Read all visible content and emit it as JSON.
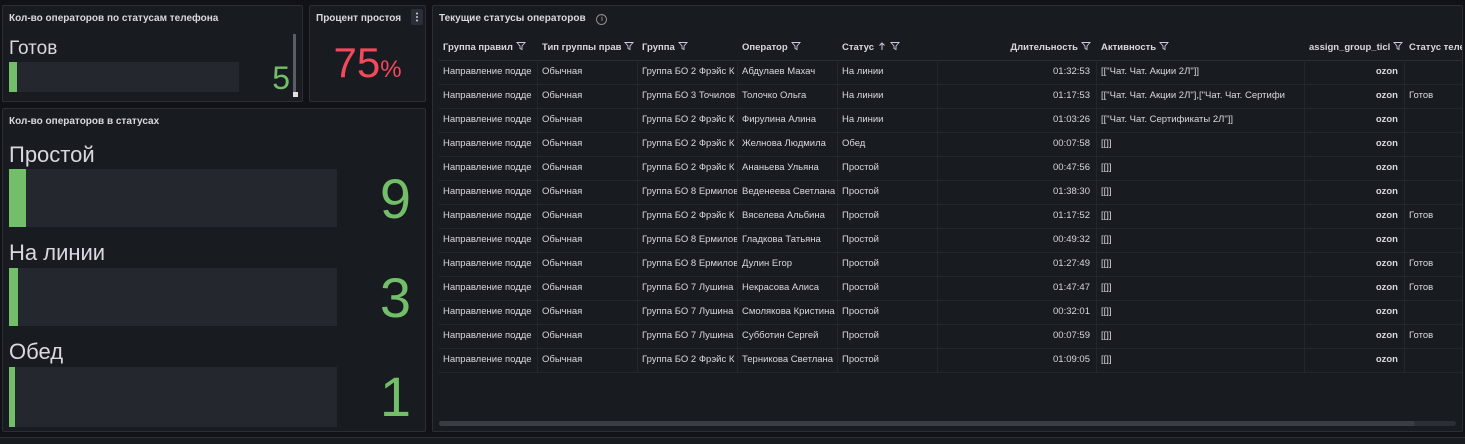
{
  "phone_panel": {
    "title": "Кол-во операторов по статусам телефона",
    "rows": [
      {
        "label": "Готов",
        "value": "5",
        "fill": 0.02
      }
    ]
  },
  "idle_panel": {
    "title": "Процент простоя",
    "value": "75",
    "unit": "%",
    "value_color": "#f2495c"
  },
  "status_panel": {
    "title": "Кол-во операторов в статусах",
    "rows": [
      {
        "label": "Простой",
        "value": "9",
        "fill": 0.036
      },
      {
        "label": "На линии",
        "value": "3",
        "fill": 0.012
      },
      {
        "label": "Обед",
        "value": "1",
        "fill": 0.004
      }
    ]
  },
  "table_panel": {
    "title": "Текущие статусы операторов",
    "columns": [
      "Группа правил",
      "Тип группы прав",
      "Группа",
      "Оператор",
      "Статус",
      "Длительность",
      "Активность",
      "assign_group_ticl",
      "Статус теле"
    ],
    "sort_column": "Статус",
    "rows": [
      [
        "Направление подде",
        "Обычная",
        "Группа БО 2 Фрэйс К",
        "Абдулаев Махач",
        "На линии",
        "01:32:53",
        "[[\"Чат. Чат. Акции 2Л\"]]",
        "ozon",
        ""
      ],
      [
        "Направление подде",
        "Обычная",
        "Группа БО 3 Точилов",
        "Толочко Ольга",
        "На линии",
        "01:17:53",
        "[[\"Чат. Чат. Акции 2Л\"],[\"Чат. Чат. Сертифи",
        "ozon",
        "Готов"
      ],
      [
        "Направление подде",
        "Обычная",
        "Группа БО 2 Фрэйс К",
        "Фирулина Алина",
        "На линии",
        "01:03:26",
        "[[\"Чат. Чат. Сертификаты 2Л\"]]",
        "ozon",
        ""
      ],
      [
        "Направление подде",
        "Обычная",
        "Группа БО 2 Фрэйс К",
        "Желнова Людмила",
        "Обед",
        "00:07:58",
        "[[]]",
        "ozon",
        ""
      ],
      [
        "Направление подде",
        "Обычная",
        "Группа БО 2 Фрэйс К",
        "Ананьева Ульяна",
        "Простой",
        "00:47:56",
        "[[]]",
        "ozon",
        ""
      ],
      [
        "Направление подде",
        "Обычная",
        "Группа БО 8 Ермилов",
        "Веденеева Светлана",
        "Простой",
        "01:38:30",
        "[[]]",
        "ozon",
        ""
      ],
      [
        "Направление подде",
        "Обычная",
        "Группа БО 2 Фрэйс К",
        "Вяселева Альбина",
        "Простой",
        "01:17:52",
        "[[]]",
        "ozon",
        "Готов"
      ],
      [
        "Направление подде",
        "Обычная",
        "Группа БО 8 Ермилов",
        "Гладкова Татьяна",
        "Простой",
        "00:49:32",
        "[[]]",
        "ozon",
        ""
      ],
      [
        "Направление подде",
        "Обычная",
        "Группа БО 8 Ермилов",
        "Дулин Егор",
        "Простой",
        "01:27:49",
        "[[]]",
        "ozon",
        "Готов"
      ],
      [
        "Направление подде",
        "Обычная",
        "Группа БО 7 Лушина",
        "Некрасова Алиса",
        "Простой",
        "01:47:47",
        "[[]]",
        "ozon",
        "Готов"
      ],
      [
        "Направление подде",
        "Обычная",
        "Группа БО 7 Лушина",
        "Смолякова Кристина",
        "Простой",
        "00:32:01",
        "[[]]",
        "ozon",
        ""
      ],
      [
        "Направление подде",
        "Обычная",
        "Группа БО 7 Лушина",
        "Субботин Сергей",
        "Простой",
        "00:07:59",
        "[[]]",
        "ozon",
        "Готов"
      ],
      [
        "Направление подде",
        "Обычная",
        "Группа БО 2 Фрэйс К",
        "Терникова Светлана",
        "Простой",
        "01:09:05",
        "[[]]",
        "ozon",
        ""
      ]
    ]
  },
  "colors": {
    "bar_green": "#73bf69",
    "value_red": "#f2495c",
    "background": "#111217",
    "panel": "#181b1f"
  }
}
